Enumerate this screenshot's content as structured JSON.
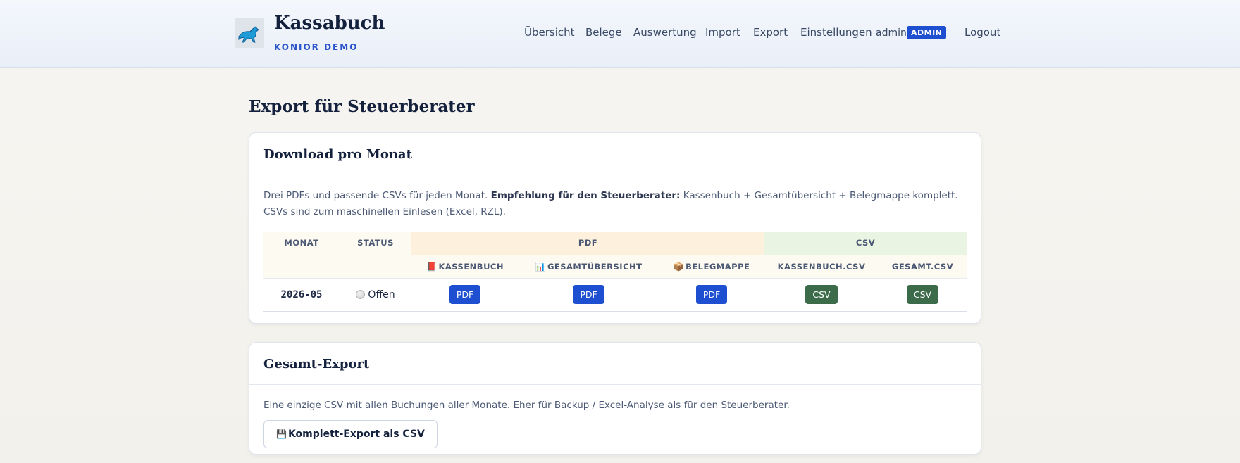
{
  "header": {
    "brand_title": "Kassabuch",
    "brand_subtitle": "KONIOR DEMO",
    "nav": [
      {
        "label": "Übersicht"
      },
      {
        "label": "Belege"
      },
      {
        "label": "Auswertung"
      },
      {
        "label": "Import"
      },
      {
        "label": "Export"
      },
      {
        "label": "Einstellungen"
      }
    ],
    "user": "admin",
    "role": "ADMIN",
    "logout": "Logout"
  },
  "page_title": "Export für Steuerberater",
  "monthly": {
    "title": "Download pro Monat",
    "desc_prefix": "Drei PDFs und passende CSVs für jeden Monat. ",
    "desc_bold": "Empfehlung für den Steuerberater:",
    "desc_suffix": " Kassenbuch + Gesamtübersicht + Belegmappe komplett. CSVs sind zum maschinellen Einlesen (Excel, RZL).",
    "headers": {
      "month": "MONAT",
      "status": "STATUS",
      "pdf": "PDF",
      "csv": "CSV",
      "kassenbuch": "KASSENBUCH",
      "kassenbuch_icon": "📕",
      "gesamt": "GESAMTÜBERSICHT",
      "gesamt_icon": "📊",
      "belegmappe": "BELEGMAPPE",
      "belegmappe_icon": "📦",
      "kassenbuch_csv": "KASSENBUCH.CSV",
      "gesamt_csv": "GESAMT.CSV"
    },
    "rows": [
      {
        "month": "2026-05",
        "status": "Offen",
        "pdf_label": "PDF",
        "csv_label": "CSV"
      }
    ]
  },
  "total": {
    "title": "Gesamt-Export",
    "desc": "Eine einzige CSV mit allen Buchungen aller Monate. Eher für Backup / Excel-Analyse als für den Steuerberater.",
    "button_icon": "💾",
    "button_label": "Komplett-Export als CSV"
  },
  "colors": {
    "accent_blue": "#1f4fd1",
    "csv_green": "#3c6b4a"
  }
}
